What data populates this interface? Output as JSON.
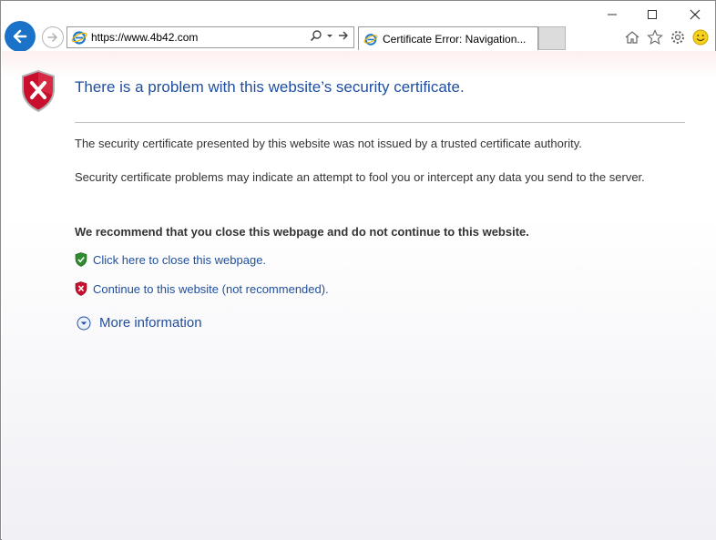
{
  "browser": {
    "address_url": "https://www.4b42.com",
    "tab_title": "Certificate Error: Navigation...",
    "colors": {
      "back_button": "#1a73c8",
      "link": "#1f4e9e",
      "error_red": "#c8102e",
      "ok_green": "#2e8b2e"
    }
  },
  "window_controls": {
    "minimize": "minimize-icon",
    "maximize": "maximize-icon",
    "close": "close-icon"
  },
  "toolbar_icons": [
    "home-icon",
    "favorites-star-icon",
    "settings-gear-icon",
    "smiley-feedback-icon"
  ],
  "page": {
    "headline": "There is a problem with this website’s security certificate.",
    "paragraph_1": "The security certificate presented by this website was not issued by a trusted certificate authority.",
    "paragraph_2": "Security certificate problems may indicate an attempt to fool you or intercept any data you send to the server.",
    "recommendation": "We recommend that you close this webpage and do not continue to this website.",
    "close_link": "Click here to close this webpage.",
    "continue_link": "Continue to this website (not recommended).",
    "more_info": "More information"
  }
}
